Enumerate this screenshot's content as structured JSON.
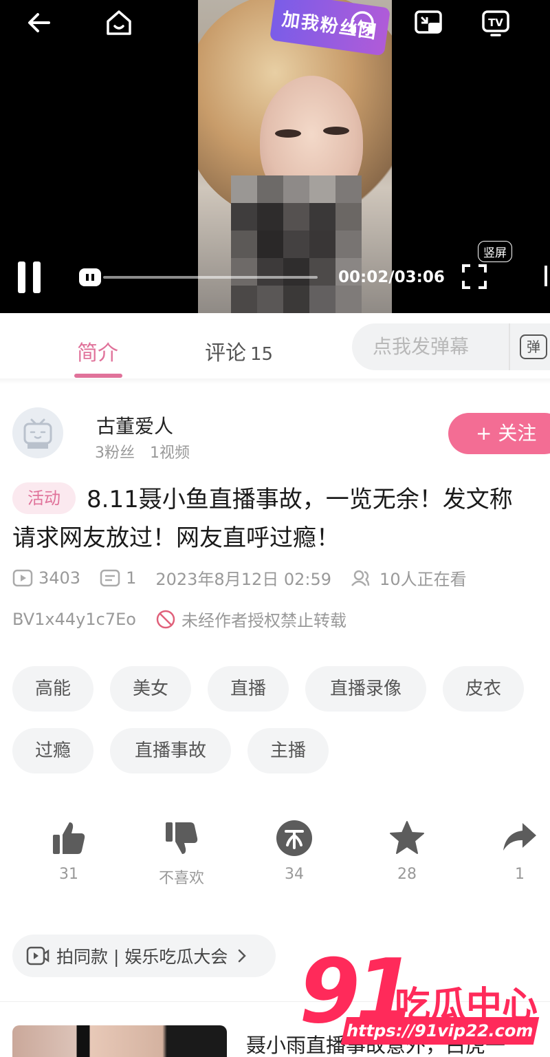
{
  "player": {
    "fan_badge": "加我粉丝团",
    "time": "00:02/03:06",
    "vertical_label": "竖屏"
  },
  "tabs": {
    "intro": "简介",
    "comments": "评论",
    "comments_count": "15",
    "danmaku_placeholder": "点我发弹幕",
    "danmaku_toggle": "弹"
  },
  "uploader": {
    "name": "古董爱人",
    "stats": "3粉丝　1视频",
    "follow": "+ 关注"
  },
  "video": {
    "badge": "活动",
    "title": "8.11聂小鱼直播事故，一览无余！发文称请求网友放过！网友直呼过瘾！",
    "plays": "3403",
    "danmaku_count": "1",
    "date": "2023年8月12日 02:59",
    "watching": "10人正在看",
    "bvid": "BV1x44y1c7Eo",
    "no_repost": "未经作者授权禁止转载"
  },
  "tags": [
    "高能",
    "美女",
    "直播",
    "直播录像",
    "皮衣",
    "过瘾",
    "直播事故",
    "主播"
  ],
  "actions": {
    "like": "31",
    "dislike": "不喜欢",
    "coin": "34",
    "favorite": "28",
    "share": "1"
  },
  "same_style": "拍同款 | 娱乐吃瓜大会",
  "recommend": {
    "title": "聂小雨直播事故意外，白虎一"
  },
  "watermark": {
    "logo": "91",
    "text": "吃瓜中心",
    "url": "https://91vip22.com"
  },
  "colors": {
    "accent": "#f36d94",
    "tab_active": "#e0729a",
    "watermark": "#ff2a5a"
  }
}
